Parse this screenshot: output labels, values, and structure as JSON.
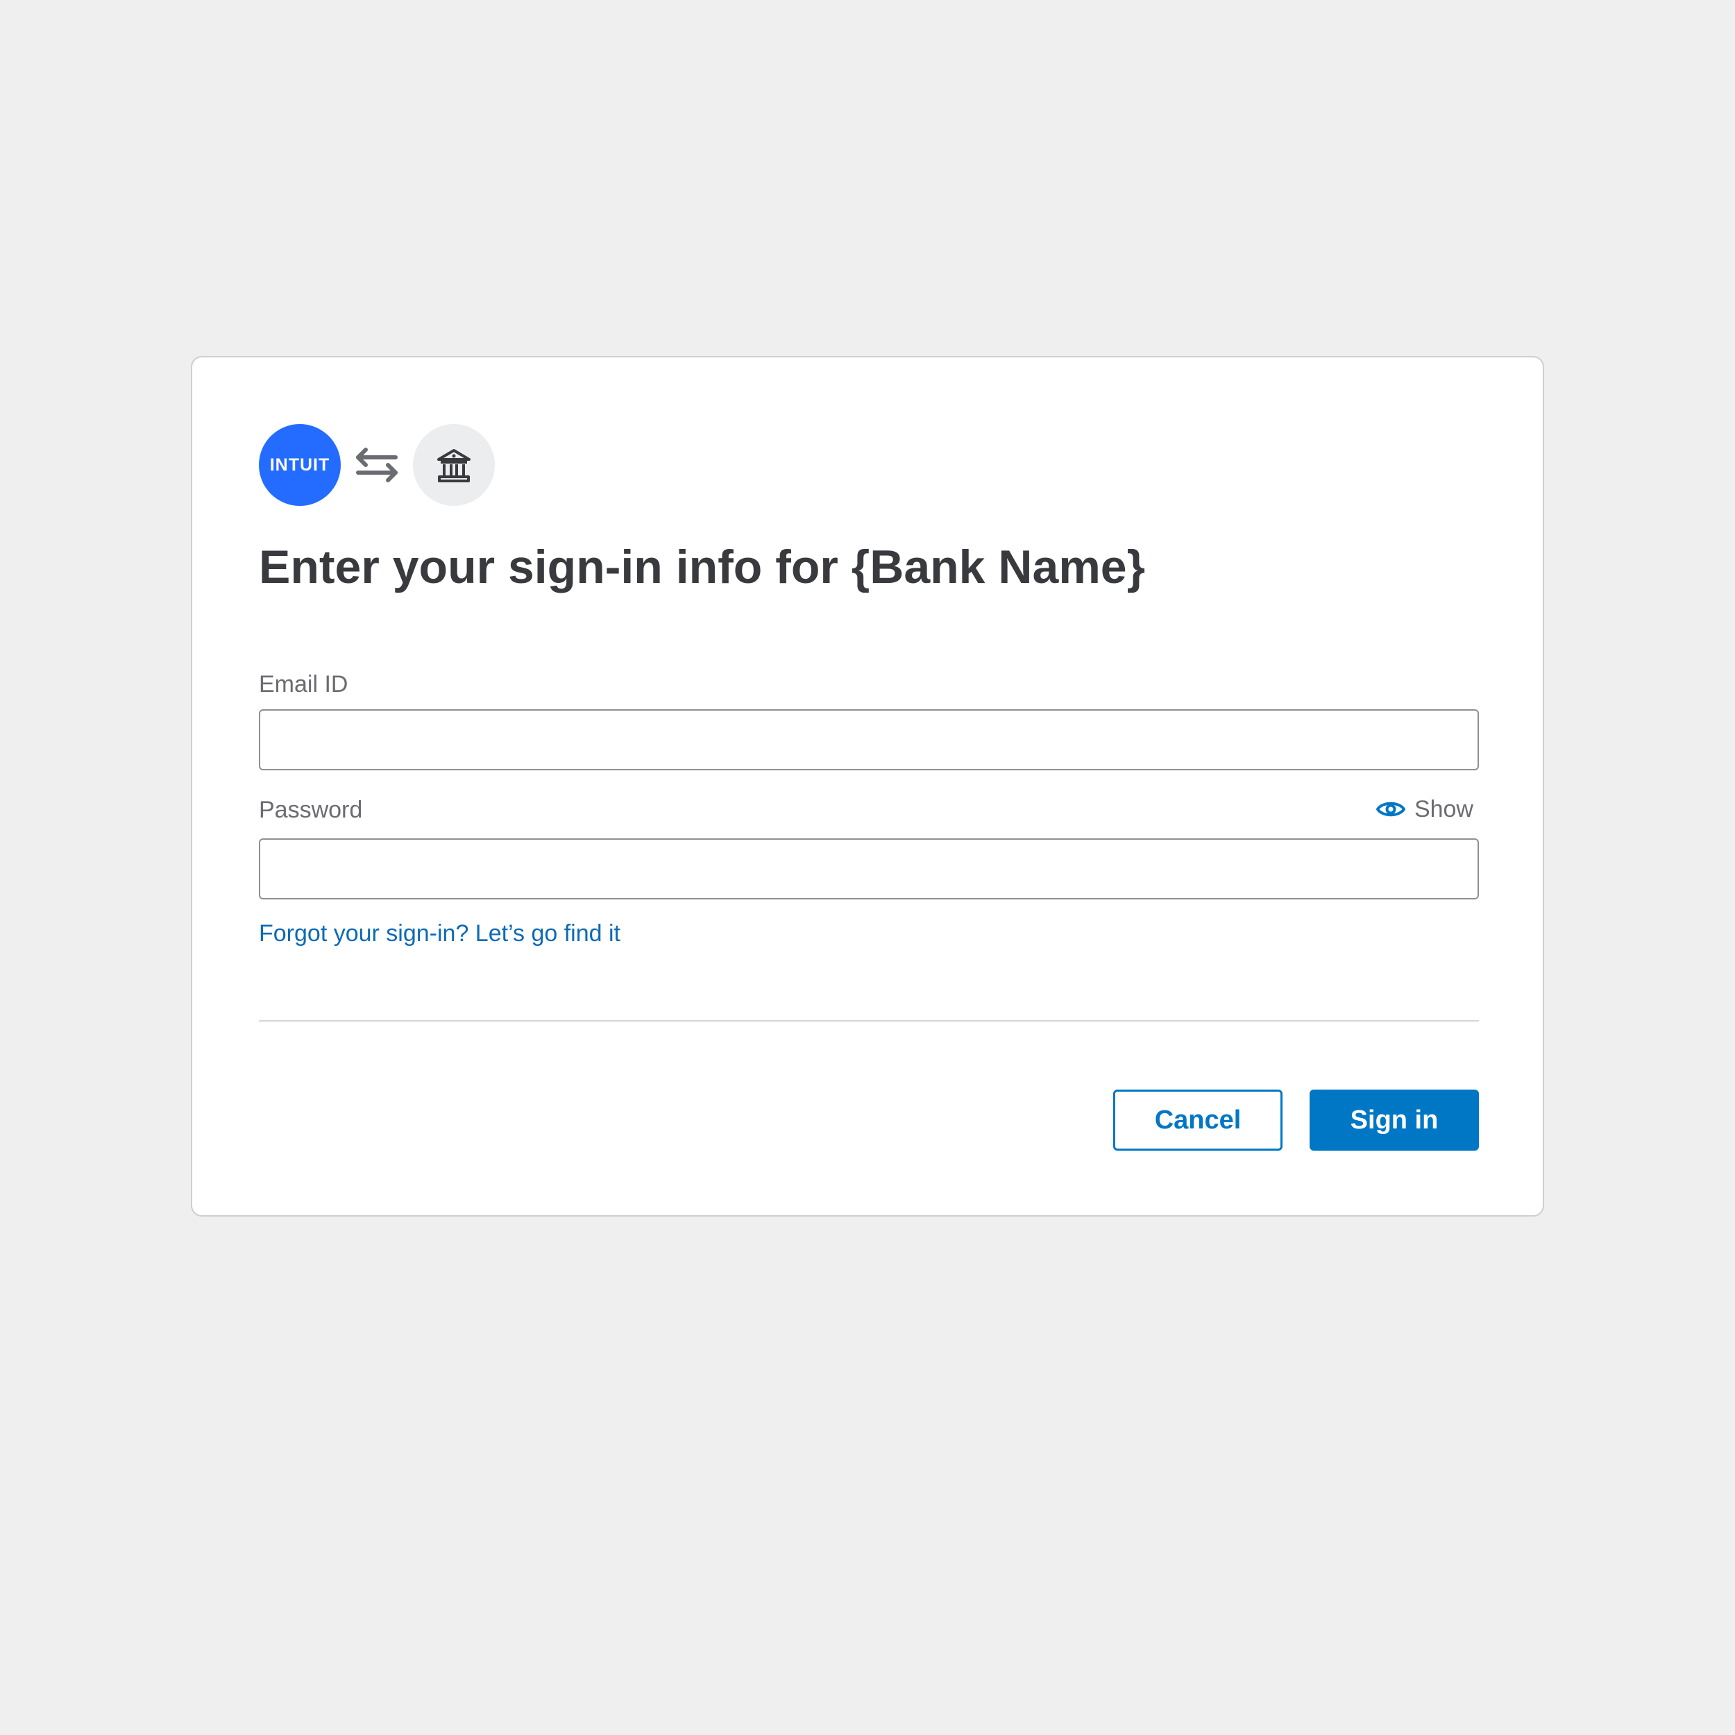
{
  "logos": {
    "intuit_text": "INTUIT",
    "intuit_color": "#236cff",
    "swap_icon": "swap-arrows-icon",
    "bank_icon": "bank-icon"
  },
  "title": "Enter your sign-in info for {Bank Name}",
  "form": {
    "email_label": "Email ID",
    "email_value": "",
    "password_label": "Password",
    "password_value": "",
    "show_label": "Show",
    "show_icon": "eye-icon",
    "forgot_link": "Forgot your sign-in? Let’s go find it"
  },
  "buttons": {
    "cancel_label": "Cancel",
    "signin_label": "Sign in"
  },
  "colors": {
    "primary": "#0077c5",
    "link": "#0d6ab6",
    "background": "#efeff0"
  }
}
